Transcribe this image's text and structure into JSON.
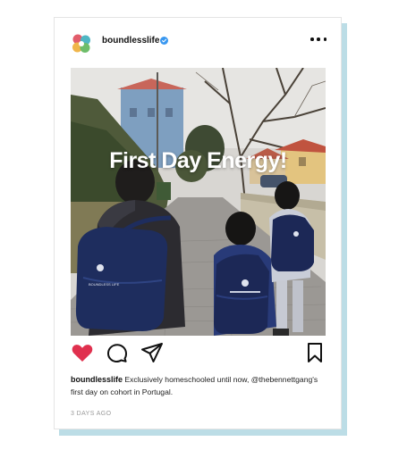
{
  "post": {
    "username": "boundlesslife",
    "overlay_text": "First Day Energy!",
    "caption_user": "boundlesslife",
    "caption_text": "Exclusively homeschooled until now, @thebennettgang's first day on cohort in Portugal.",
    "timestamp": "3 DAYS AGO",
    "liked": true,
    "backpack_text": "BOUNDLESS LIFE"
  },
  "icons": {
    "verified": "verified-badge-icon",
    "more": "more-options-icon",
    "like": "heart-icon",
    "comment": "comment-icon",
    "share": "send-icon",
    "save": "bookmark-icon"
  },
  "colors": {
    "like": "#e0304e",
    "verified": "#3897f0",
    "shadow": "#bcdde6"
  }
}
